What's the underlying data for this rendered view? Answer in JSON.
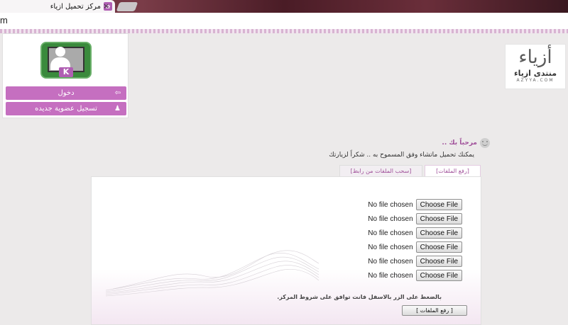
{
  "browser": {
    "tab_title": "مركز تحميل ازياء",
    "close_glyph": "×",
    "url": "m"
  },
  "user_panel": {
    "login_label": "دخول",
    "register_label": "تسجيل عضوية جديده",
    "login_icon": "login-arrow-icon",
    "register_icon": "user-add-icon"
  },
  "logo": {
    "mark": "أزياء",
    "name": "منتدى ازياء",
    "domain": "AZYYA.COM"
  },
  "welcome": {
    "greeting": "مرحباً بك ..",
    "instructions": "يمكنك تحميل ماتشاء وفق المسموح به .. شكراً لزيارتك"
  },
  "tabs": [
    {
      "label": "[رفع الملفات]",
      "active": true
    },
    {
      "label": "[سحب الملفات من رابط]",
      "active": false
    }
  ],
  "upload": {
    "rows": [
      {
        "status": "No file chosen",
        "button": "Choose File"
      },
      {
        "status": "No file chosen",
        "button": "Choose File"
      },
      {
        "status": "No file chosen",
        "button": "Choose File"
      },
      {
        "status": "No file chosen",
        "button": "Choose File"
      },
      {
        "status": "No file chosen",
        "button": "Choose File"
      },
      {
        "status": "No file chosen",
        "button": "Choose File"
      }
    ],
    "agree_text": "بالضغط على الزر بالاسفل فانت توافق على شروط المركز.",
    "submit_label": "[ رفع الملفات ]"
  },
  "colors": {
    "accent": "#c56fc0",
    "accent_text": "#a0509a"
  }
}
